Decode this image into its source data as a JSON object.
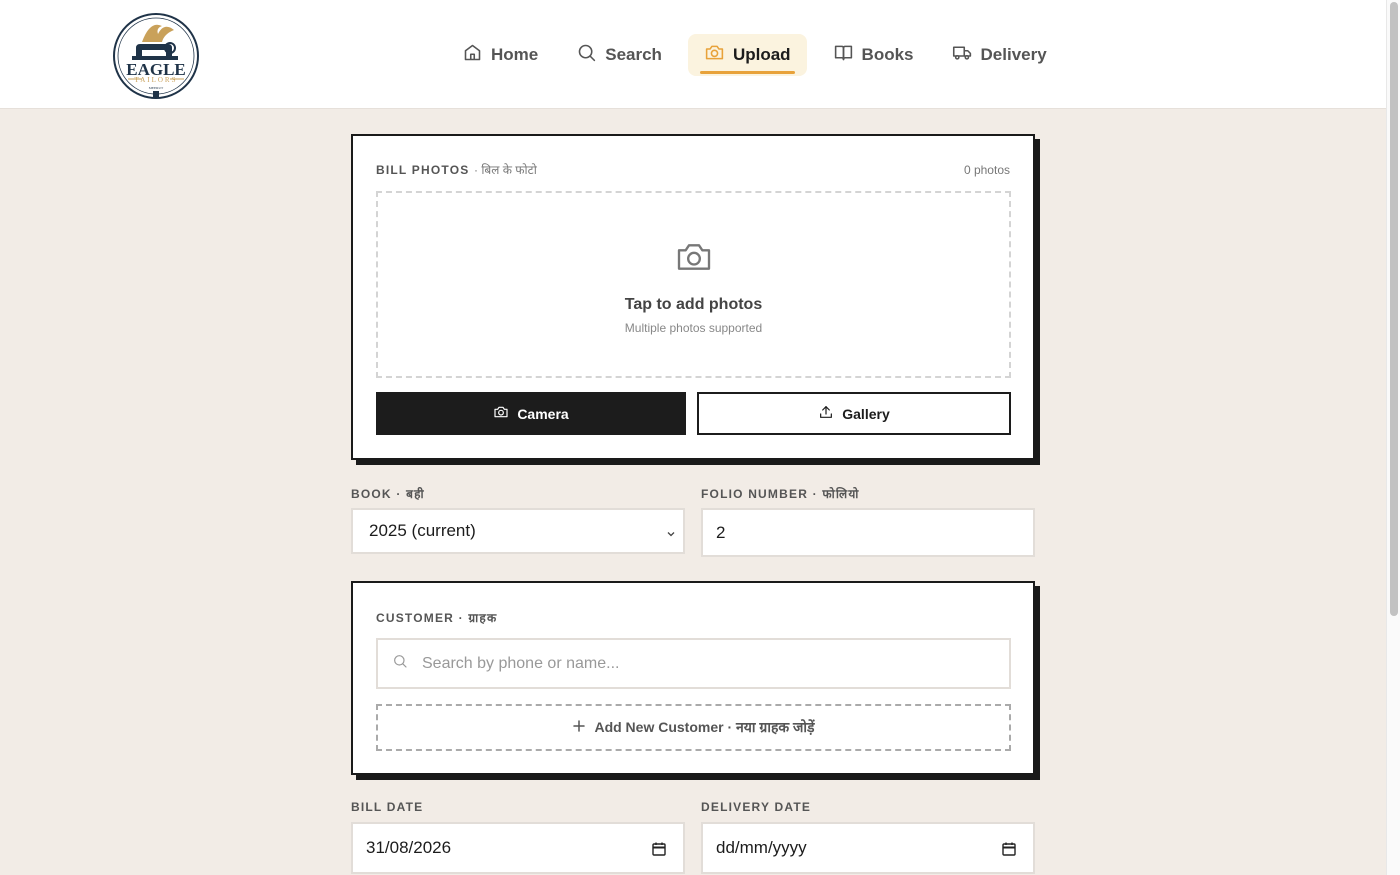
{
  "brand": {
    "logo_name": "EAGLE",
    "logo_sub": "TAILORS",
    "logo_city": "MEERUT"
  },
  "nav": {
    "items": [
      {
        "label": "Home",
        "icon": "home-icon",
        "active": false
      },
      {
        "label": "Search",
        "icon": "search-icon",
        "active": false
      },
      {
        "label": "Upload",
        "icon": "camera-icon",
        "active": true
      },
      {
        "label": "Books",
        "icon": "book-icon",
        "active": false
      },
      {
        "label": "Delivery",
        "icon": "truck-icon",
        "active": false
      }
    ]
  },
  "photos": {
    "label": "BILL PHOTOS",
    "label_hindi": "· बिल के फोटो",
    "count": "0 photos",
    "drop_title": "Tap to add photos",
    "drop_sub": "Multiple photos supported",
    "camera_label": "Camera",
    "gallery_label": "Gallery"
  },
  "book": {
    "label": "BOOK · बही",
    "selected": "2025 (current)"
  },
  "folio": {
    "label": "FOLIO NUMBER · फोलियो",
    "value": "2"
  },
  "customer": {
    "label": "CUSTOMER · ग्राहक",
    "search_placeholder": "Search by phone or name...",
    "add_label": "Add New Customer · नया ग्राहक जोड़ें"
  },
  "dates": {
    "bill_label": "BILL DATE",
    "bill_value": "31/08/2026",
    "delivery_label": "DELIVERY DATE",
    "delivery_value": "dd/mm/yyyy"
  },
  "colors": {
    "background": "#f2ece6",
    "accent": "#e8a23a",
    "active_nav_bg": "#fbf3df",
    "dark": "#1c1c1c"
  }
}
